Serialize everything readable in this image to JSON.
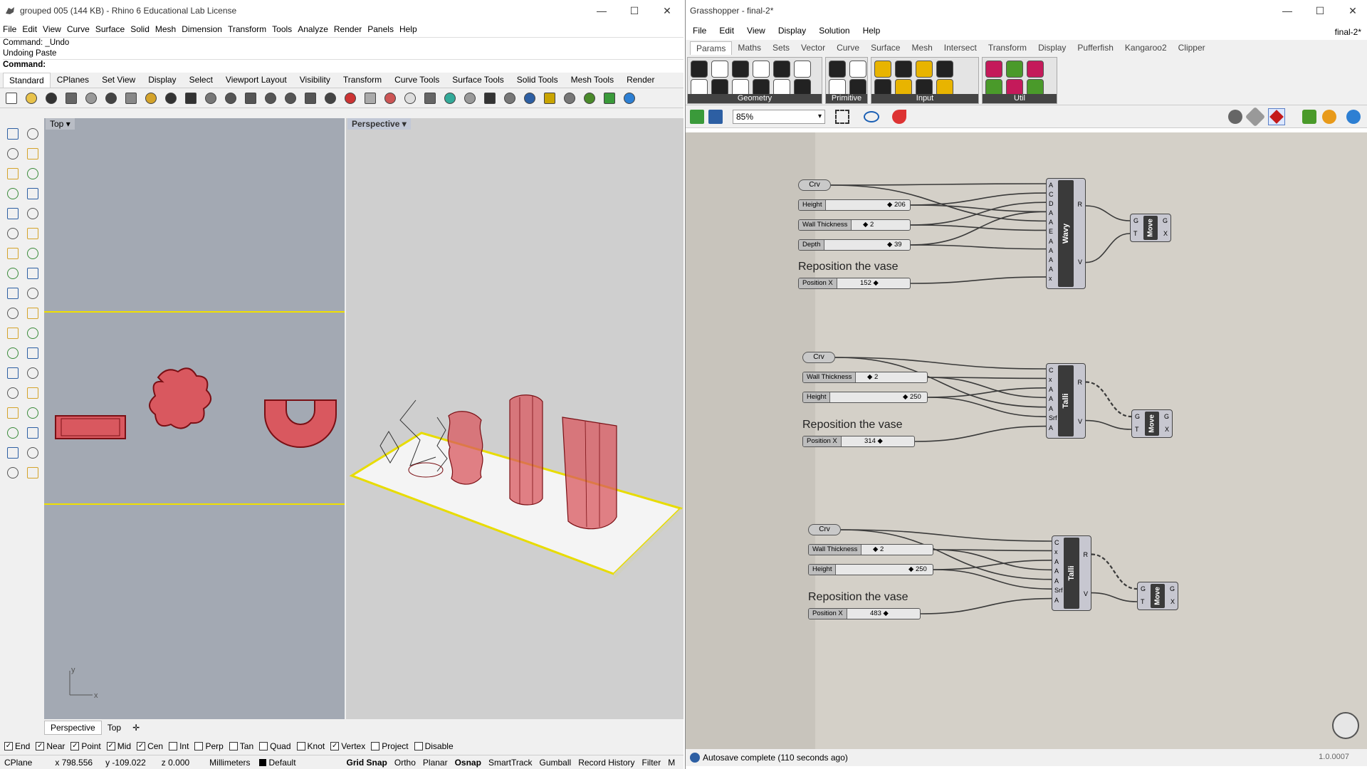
{
  "rhino": {
    "title": "grouped 005 (144 KB) - Rhino 6 Educational Lab License",
    "menu": [
      "File",
      "Edit",
      "View",
      "Curve",
      "Surface",
      "Solid",
      "Mesh",
      "Dimension",
      "Transform",
      "Tools",
      "Analyze",
      "Render",
      "Panels",
      "Help"
    ],
    "command_history": [
      "Command: _Undo",
      "Undoing Paste"
    ],
    "command_prompt": "Command:",
    "toolbar_tabs": [
      "Standard",
      "CPlanes",
      "Set View",
      "Display",
      "Select",
      "Viewport Layout",
      "Visibility",
      "Transform",
      "Curve Tools",
      "Surface Tools",
      "Solid Tools",
      "Mesh Tools",
      "Render"
    ],
    "viewport_top_label": "Top",
    "viewport_persp_label": "Perspective",
    "axis_y": "y",
    "axis_x": "x",
    "viewport_tabs": [
      "Perspective",
      "Top"
    ],
    "osnaps": [
      {
        "label": "End",
        "checked": true
      },
      {
        "label": "Near",
        "checked": true
      },
      {
        "label": "Point",
        "checked": true
      },
      {
        "label": "Mid",
        "checked": true
      },
      {
        "label": "Cen",
        "checked": true
      },
      {
        "label": "Int",
        "checked": false
      },
      {
        "label": "Perp",
        "checked": false
      },
      {
        "label": "Tan",
        "checked": false
      },
      {
        "label": "Quad",
        "checked": false
      },
      {
        "label": "Knot",
        "checked": false
      },
      {
        "label": "Vertex",
        "checked": true
      },
      {
        "label": "Project",
        "checked": false
      },
      {
        "label": "Disable",
        "checked": false
      }
    ],
    "status": {
      "cplane": "CPlane",
      "x": "x 798.556",
      "y": "y -109.022",
      "z": "z 0.000",
      "units": "Millimeters",
      "layer": "Default",
      "toggles": [
        "Grid Snap",
        "Ortho",
        "Planar",
        "Osnap",
        "SmartTrack",
        "Gumball",
        "Record History",
        "Filter",
        "M"
      ]
    },
    "colors": {
      "vase_red": "#d9585f",
      "top_bg": "#a3a9b3",
      "persp_bg": "#cfcfcf",
      "selection": "#f0e000"
    }
  },
  "grasshopper": {
    "title": "Grasshopper - final-2*",
    "doc_name": "final-2*",
    "menu": [
      "File",
      "Edit",
      "View",
      "Display",
      "Solution",
      "Help"
    ],
    "tabs": [
      "Params",
      "Maths",
      "Sets",
      "Vector",
      "Curve",
      "Surface",
      "Mesh",
      "Intersect",
      "Transform",
      "Display",
      "Pufferfish",
      "Kangaroo2",
      "Clipper"
    ],
    "ribbon_groups": [
      "Geometry",
      "Primitive",
      "Input",
      "Util"
    ],
    "zoom": "85%",
    "status": "Autosave complete (110 seconds ago)",
    "version": "1.0.0007",
    "groups": [
      {
        "param_label": "Crv",
        "sliders": [
          {
            "name": "Height",
            "value": "206"
          },
          {
            "name": "Wall Thickness",
            "value": "2"
          },
          {
            "name": "Depth",
            "value": "39"
          }
        ],
        "heading": "Reposition the vase",
        "position_slider": {
          "name": "Position X",
          "value": "152"
        },
        "component": "Wavy",
        "inputs": [
          "A",
          "C",
          "D",
          "A",
          "A",
          "E",
          "A",
          "A",
          "A",
          "A",
          "x"
        ],
        "outputs": [
          "R",
          "V"
        ],
        "move": {
          "name": "Move",
          "inputs": [
            "G",
            "T"
          ],
          "outputs": [
            "G",
            "X"
          ]
        }
      },
      {
        "param_label": "Crv",
        "sliders": [
          {
            "name": "Wall Thickness",
            "value": "2"
          },
          {
            "name": "Height",
            "value": "250"
          }
        ],
        "heading": "Reposition the vase",
        "position_slider": {
          "name": "Position X",
          "value": "314"
        },
        "component": "Talli",
        "inputs": [
          "C",
          "x",
          "A",
          "A",
          "A",
          "Srf",
          "A"
        ],
        "outputs": [
          "R",
          "V"
        ],
        "move": {
          "name": "Move",
          "inputs": [
            "G",
            "T"
          ],
          "outputs": [
            "G",
            "X"
          ]
        }
      },
      {
        "param_label": "Crv",
        "sliders": [
          {
            "name": "Wall Thickness",
            "value": "2"
          },
          {
            "name": "Height",
            "value": "250"
          }
        ],
        "heading": "Reposition the vase",
        "position_slider": {
          "name": "Position X",
          "value": "483"
        },
        "component": "Talli",
        "inputs": [
          "C",
          "x",
          "A",
          "A",
          "A",
          "Srf",
          "A"
        ],
        "outputs": [
          "R",
          "V"
        ],
        "move": {
          "name": "Move",
          "inputs": [
            "G",
            "T"
          ],
          "outputs": [
            "G",
            "X"
          ]
        }
      }
    ]
  }
}
